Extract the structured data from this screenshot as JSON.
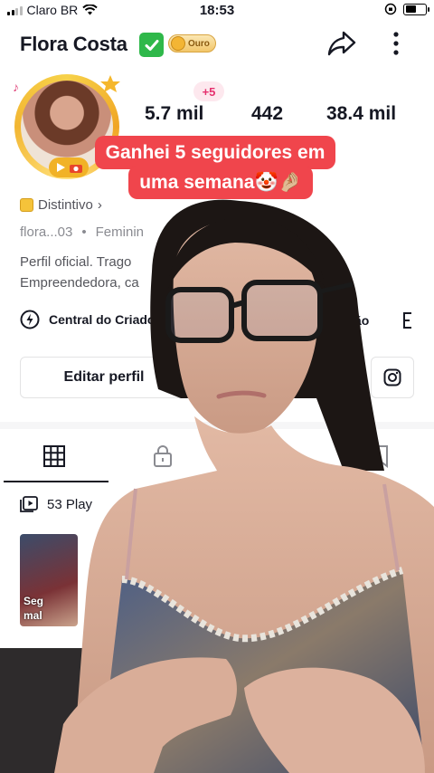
{
  "status_bar": {
    "carrier": "Claro BR",
    "time": "18:53",
    "battery_level": 0.55
  },
  "header": {
    "profile_name": "Flora Costa",
    "verified_icon": "green-check-icon",
    "tier_label": "Ouro"
  },
  "stats": {
    "followers_delta": "+5",
    "items": [
      {
        "value": "5.7 mil"
      },
      {
        "value": "442"
      },
      {
        "value": "38.4 mil"
      }
    ]
  },
  "caption": {
    "line1": "Ganhei 5 seguidores em",
    "line2": "uma semana🤡🤌🏼"
  },
  "profile": {
    "distintivo_label": "Distintivo",
    "username": "flora...03",
    "gender": "Feminin",
    "bio_line1": "Perfil oficial. Trago",
    "bio_line2": "Empreendedora, ca",
    "creator_center": "Central do Criado",
    "tool_peek": "ão",
    "edit_profile": "Editar perfil"
  },
  "content": {
    "playlists": "53 Play",
    "thumb_text_line1": "Seg",
    "thumb_text_line2": "mal"
  },
  "colors": {
    "caption_bg": "#f0454c",
    "delta_text": "#e5306e",
    "verified": "#2fb84a",
    "gold": "#f1b227"
  }
}
